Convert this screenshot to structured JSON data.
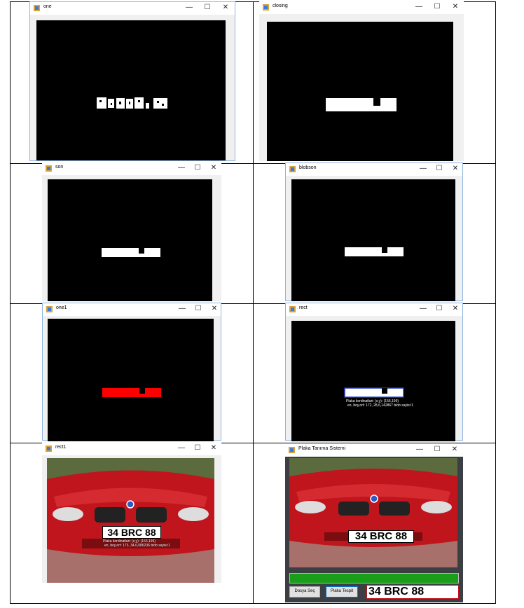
{
  "windows": {
    "one": {
      "title": "one"
    },
    "closing": {
      "title": "closing"
    },
    "son": {
      "title": "son"
    },
    "blobson": {
      "title": "blobson"
    },
    "one1": {
      "title": "one1"
    },
    "rect": {
      "title": "rect",
      "info_line1": "Plaka kordinatlari: (x,y): (156,199)",
      "info_line2": "en, boy,ort: 172, 28,6,142867 blob sayisi:1"
    },
    "rect1": {
      "title": "rect1",
      "plate_text": "34 BRC 88",
      "info_line1": "Plaka kordinatlari: (x,y): (153,196)",
      "info_line2": "en, boy,ort: 173, 34,6,086236 blob sayisi:1"
    },
    "main": {
      "title": "Plaka Tanıma Sistemi",
      "plate_text": "34 BRC 88",
      "open_button": "Dosya Seç",
      "detect_button": "Plaka Tespit",
      "result_text": "34 BRC 88",
      "progress": 1.0
    }
  },
  "controls": {
    "minimize": "—",
    "maximize": "☐",
    "close": "✕"
  },
  "colors": {
    "accent": "#1a9e1a",
    "red_mask": "#ff0000",
    "car_red": "#c0151c"
  }
}
